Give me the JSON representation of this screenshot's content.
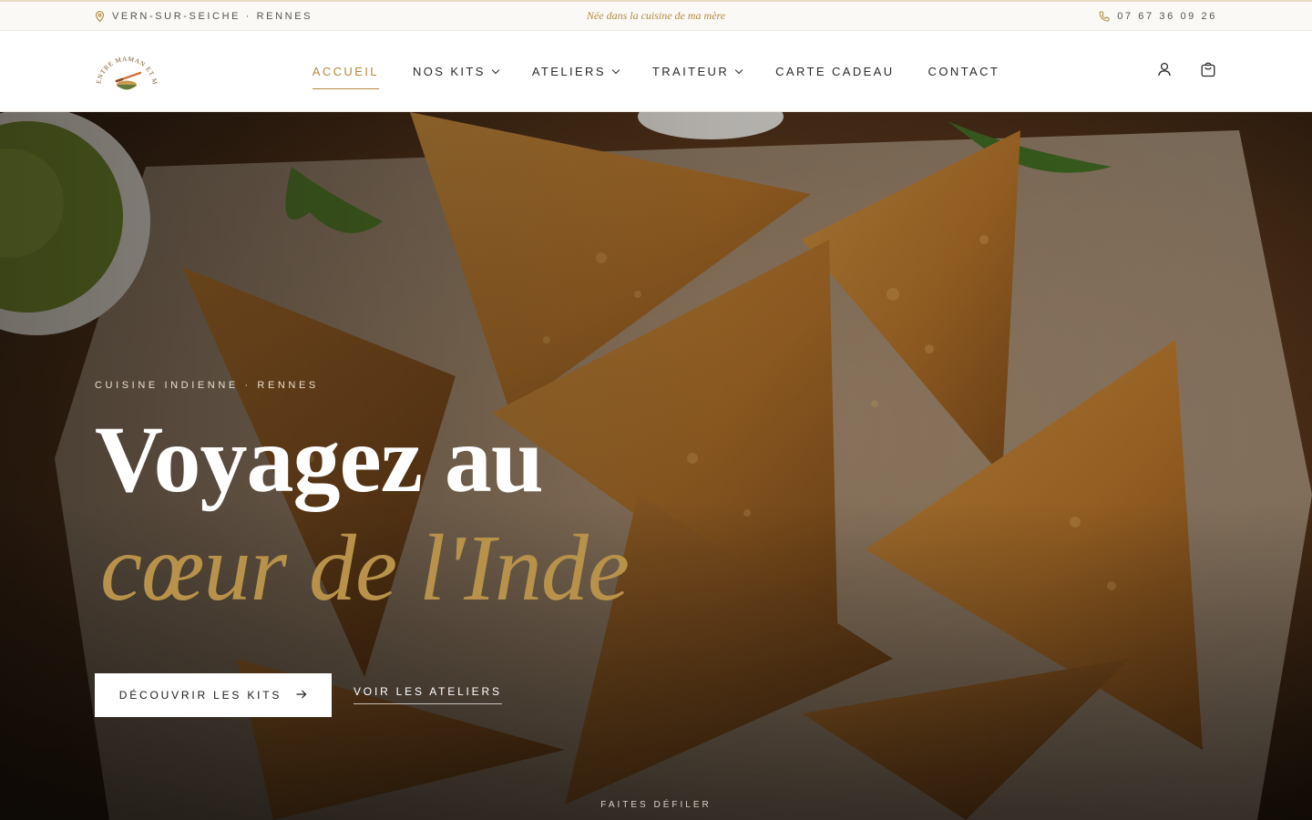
{
  "topbar": {
    "location": "VERN-SUR-SEICHE · RENNES",
    "tagline": "Née dans la cuisine de ma mère",
    "phone": "07 67 36 09 26"
  },
  "logo": {
    "text_top": "ENTRE MAMAN ET MOI"
  },
  "nav": {
    "items": [
      {
        "label": "ACCUEIL",
        "active": true
      },
      {
        "label": "NOS KITS",
        "dropdown": true
      },
      {
        "label": "ATELIERS",
        "dropdown": true
      },
      {
        "label": "TRAITEUR",
        "dropdown": true
      },
      {
        "label": "CARTE CADEAU"
      },
      {
        "label": "CONTACT"
      }
    ]
  },
  "header_icons": [
    "user-icon",
    "cart-icon"
  ],
  "hero": {
    "eyebrow": "CUISINE INDIENNE · RENNES",
    "title_line1": "Voyagez au",
    "title_line2": "cœur de l'Inde",
    "primary_cta": "DÉCOUVRIR LES KITS",
    "secondary_cta": "VOIR LES ATELIERS",
    "scroll_hint": "FAITES DÉFILER"
  },
  "colors": {
    "accent_gold": "#b08a3e",
    "title_gold": "#b8924a",
    "topbar_bg": "#fbf9f6"
  }
}
